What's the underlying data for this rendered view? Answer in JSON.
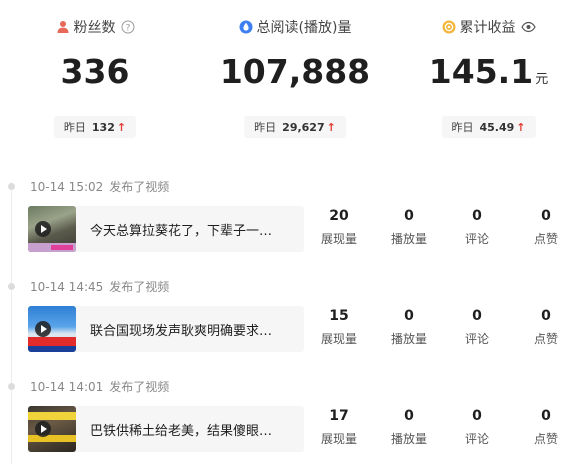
{
  "colors": {
    "fans_icon": "#e8685a",
    "reads_icon": "#3d7ef0",
    "income_icon": "#f3b63a",
    "up_arrow": "#e33e33"
  },
  "stats": [
    {
      "label": "粉丝数",
      "icon": "person-icon",
      "suffix_icon": "help-circle-icon",
      "value": "336",
      "unit": "",
      "yesterday_label": "昨日",
      "yesterday_value": "132",
      "trend": "↑"
    },
    {
      "label": "总阅读(播放)量",
      "icon": "drop-icon",
      "suffix_icon": "",
      "value": "107,888",
      "unit": "",
      "yesterday_label": "昨日",
      "yesterday_value": "29,627",
      "trend": "↑"
    },
    {
      "label": "累计收益",
      "icon": "coin-icon",
      "suffix_icon": "eye-icon",
      "value": "145.1",
      "unit": "元",
      "yesterday_label": "昨日",
      "yesterday_value": "45.49",
      "trend": "↑"
    }
  ],
  "metric_labels": [
    "展现量",
    "播放量",
    "评论",
    "点赞"
  ],
  "posts": [
    {
      "time": "10-14 15:02",
      "action": "发布了视频",
      "title": "今天总算拉葵花了，下辈子一…",
      "metrics": [
        "20",
        "0",
        "0",
        "0"
      ]
    },
    {
      "time": "10-14 14:45",
      "action": "发布了视频",
      "title": "联合国现场发声耿爽明确要求…",
      "metrics": [
        "15",
        "0",
        "0",
        "0"
      ]
    },
    {
      "time": "10-14 14:01",
      "action": "发布了视频",
      "title": "巴铁供稀土给老美，结果傻眼…",
      "metrics": [
        "17",
        "0",
        "0",
        "0"
      ]
    }
  ]
}
